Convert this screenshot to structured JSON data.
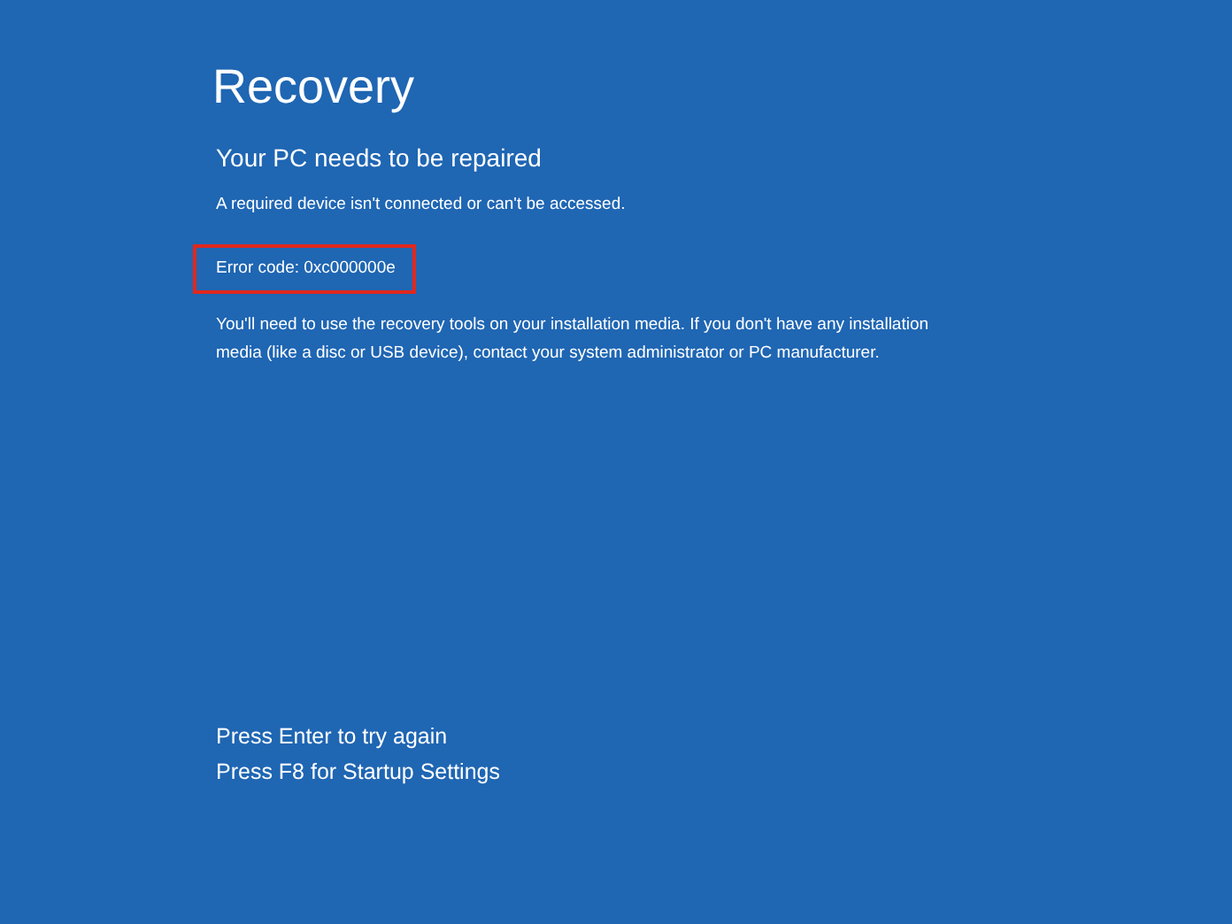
{
  "title": "Recovery",
  "subtitle": "Your PC needs to be repaired",
  "message": "A required device isn't connected or can't be accessed.",
  "error_code": {
    "text": "Error code: 0xc000000e",
    "highlighted": true
  },
  "instructions": "You'll need to use the recovery tools on your installation media. If you don't have any installation media (like a disc or USB device), contact your system administrator or PC manufacturer.",
  "options": [
    "Press Enter to try again",
    "Press F8 for Startup Settings"
  ]
}
